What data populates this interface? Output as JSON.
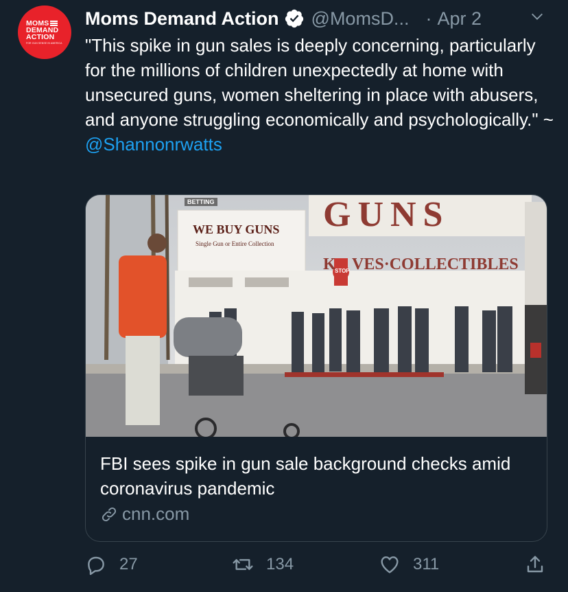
{
  "avatar": {
    "line1": "MOMS",
    "line2": "DEMAND",
    "line3": "ACTION",
    "line4": "FOR GUN SENSE IN AMERICA",
    "color": "#e8222a"
  },
  "tweet": {
    "display_name": "Moms Demand Action",
    "verified_icon": "verified-badge-icon",
    "handle": "@MomsD...",
    "separator": "·",
    "date": "Apr 2",
    "text": "\"This spike in gun sales is deeply concerning, particularly for the millions of children unexpectedly at home with unsecured guns, women sheltering in place with abusers, and anyone struggling economically and psychologically.\" ~",
    "mention": "@Shannonrwatts"
  },
  "card": {
    "image_signs": {
      "top_left": "BETTING",
      "we_buy": "WE BUY GUNS",
      "we_buy_sub": "Single Gun or Entire Collection",
      "big": "GUNS",
      "collectibles_left": "K",
      "collectibles_right": "VES·COLLECTIBLES",
      "stop": "STOP"
    },
    "title": "FBI sees spike in gun sale background checks amid coronavirus pandemic",
    "domain": "cnn.com",
    "link_icon": "link-icon"
  },
  "actions": {
    "reply_count": "27",
    "retweet_count": "134",
    "like_count": "311"
  },
  "colors": {
    "background": "#15202b",
    "secondary_text": "#8899a6",
    "link": "#1da1f2",
    "border": "#38444d"
  }
}
